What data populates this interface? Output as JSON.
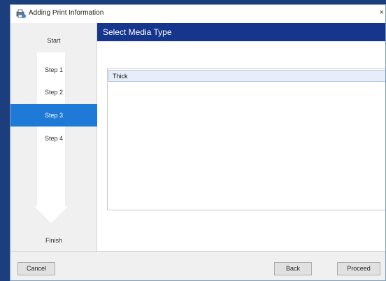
{
  "window": {
    "title": "Adding Print Information",
    "close_glyph": "×",
    "icon": "printer-settings-icon"
  },
  "sidebar": {
    "steps": [
      {
        "label": "Start"
      },
      {
        "label": "Step 1"
      },
      {
        "label": "Step 2"
      },
      {
        "label": "Step 3",
        "active": true
      },
      {
        "label": "Step 4"
      },
      {
        "label": "Finish"
      }
    ],
    "accent_color": "#1e7ad6"
  },
  "main": {
    "header": "Select Media Type",
    "header_color": "#16358c",
    "list_items": [
      "Thick"
    ]
  },
  "footer": {
    "cancel_label": "Cancel",
    "back_label": "Back",
    "proceed_label": "Proceed"
  }
}
